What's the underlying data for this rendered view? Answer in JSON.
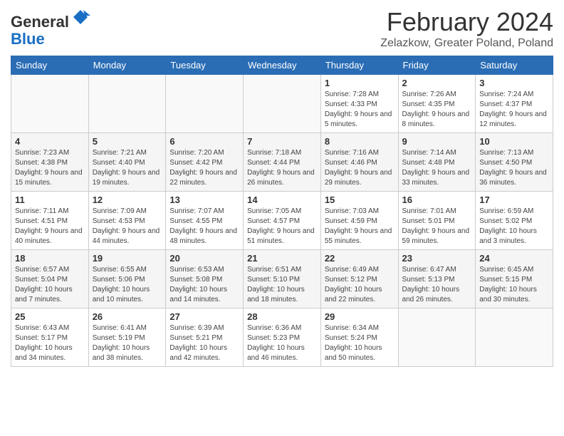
{
  "header": {
    "logo_general": "General",
    "logo_blue": "Blue",
    "title": "February 2024",
    "subtitle": "Zelazkow, Greater Poland, Poland"
  },
  "days_of_week": [
    "Sunday",
    "Monday",
    "Tuesday",
    "Wednesday",
    "Thursday",
    "Friday",
    "Saturday"
  ],
  "weeks": [
    [
      {
        "day": "",
        "info": ""
      },
      {
        "day": "",
        "info": ""
      },
      {
        "day": "",
        "info": ""
      },
      {
        "day": "",
        "info": ""
      },
      {
        "day": "1",
        "info": "Sunrise: 7:28 AM\nSunset: 4:33 PM\nDaylight: 9 hours\nand 5 minutes."
      },
      {
        "day": "2",
        "info": "Sunrise: 7:26 AM\nSunset: 4:35 PM\nDaylight: 9 hours\nand 8 minutes."
      },
      {
        "day": "3",
        "info": "Sunrise: 7:24 AM\nSunset: 4:37 PM\nDaylight: 9 hours\nand 12 minutes."
      }
    ],
    [
      {
        "day": "4",
        "info": "Sunrise: 7:23 AM\nSunset: 4:38 PM\nDaylight: 9 hours\nand 15 minutes."
      },
      {
        "day": "5",
        "info": "Sunrise: 7:21 AM\nSunset: 4:40 PM\nDaylight: 9 hours\nand 19 minutes."
      },
      {
        "day": "6",
        "info": "Sunrise: 7:20 AM\nSunset: 4:42 PM\nDaylight: 9 hours\nand 22 minutes."
      },
      {
        "day": "7",
        "info": "Sunrise: 7:18 AM\nSunset: 4:44 PM\nDaylight: 9 hours\nand 26 minutes."
      },
      {
        "day": "8",
        "info": "Sunrise: 7:16 AM\nSunset: 4:46 PM\nDaylight: 9 hours\nand 29 minutes."
      },
      {
        "day": "9",
        "info": "Sunrise: 7:14 AM\nSunset: 4:48 PM\nDaylight: 9 hours\nand 33 minutes."
      },
      {
        "day": "10",
        "info": "Sunrise: 7:13 AM\nSunset: 4:50 PM\nDaylight: 9 hours\nand 36 minutes."
      }
    ],
    [
      {
        "day": "11",
        "info": "Sunrise: 7:11 AM\nSunset: 4:51 PM\nDaylight: 9 hours\nand 40 minutes."
      },
      {
        "day": "12",
        "info": "Sunrise: 7:09 AM\nSunset: 4:53 PM\nDaylight: 9 hours\nand 44 minutes."
      },
      {
        "day": "13",
        "info": "Sunrise: 7:07 AM\nSunset: 4:55 PM\nDaylight: 9 hours\nand 48 minutes."
      },
      {
        "day": "14",
        "info": "Sunrise: 7:05 AM\nSunset: 4:57 PM\nDaylight: 9 hours\nand 51 minutes."
      },
      {
        "day": "15",
        "info": "Sunrise: 7:03 AM\nSunset: 4:59 PM\nDaylight: 9 hours\nand 55 minutes."
      },
      {
        "day": "16",
        "info": "Sunrise: 7:01 AM\nSunset: 5:01 PM\nDaylight: 9 hours\nand 59 minutes."
      },
      {
        "day": "17",
        "info": "Sunrise: 6:59 AM\nSunset: 5:02 PM\nDaylight: 10 hours\nand 3 minutes."
      }
    ],
    [
      {
        "day": "18",
        "info": "Sunrise: 6:57 AM\nSunset: 5:04 PM\nDaylight: 10 hours\nand 7 minutes."
      },
      {
        "day": "19",
        "info": "Sunrise: 6:55 AM\nSunset: 5:06 PM\nDaylight: 10 hours\nand 10 minutes."
      },
      {
        "day": "20",
        "info": "Sunrise: 6:53 AM\nSunset: 5:08 PM\nDaylight: 10 hours\nand 14 minutes."
      },
      {
        "day": "21",
        "info": "Sunrise: 6:51 AM\nSunset: 5:10 PM\nDaylight: 10 hours\nand 18 minutes."
      },
      {
        "day": "22",
        "info": "Sunrise: 6:49 AM\nSunset: 5:12 PM\nDaylight: 10 hours\nand 22 minutes."
      },
      {
        "day": "23",
        "info": "Sunrise: 6:47 AM\nSunset: 5:13 PM\nDaylight: 10 hours\nand 26 minutes."
      },
      {
        "day": "24",
        "info": "Sunrise: 6:45 AM\nSunset: 5:15 PM\nDaylight: 10 hours\nand 30 minutes."
      }
    ],
    [
      {
        "day": "25",
        "info": "Sunrise: 6:43 AM\nSunset: 5:17 PM\nDaylight: 10 hours\nand 34 minutes."
      },
      {
        "day": "26",
        "info": "Sunrise: 6:41 AM\nSunset: 5:19 PM\nDaylight: 10 hours\nand 38 minutes."
      },
      {
        "day": "27",
        "info": "Sunrise: 6:39 AM\nSunset: 5:21 PM\nDaylight: 10 hours\nand 42 minutes."
      },
      {
        "day": "28",
        "info": "Sunrise: 6:36 AM\nSunset: 5:23 PM\nDaylight: 10 hours\nand 46 minutes."
      },
      {
        "day": "29",
        "info": "Sunrise: 6:34 AM\nSunset: 5:24 PM\nDaylight: 10 hours\nand 50 minutes."
      },
      {
        "day": "",
        "info": ""
      },
      {
        "day": "",
        "info": ""
      }
    ]
  ]
}
